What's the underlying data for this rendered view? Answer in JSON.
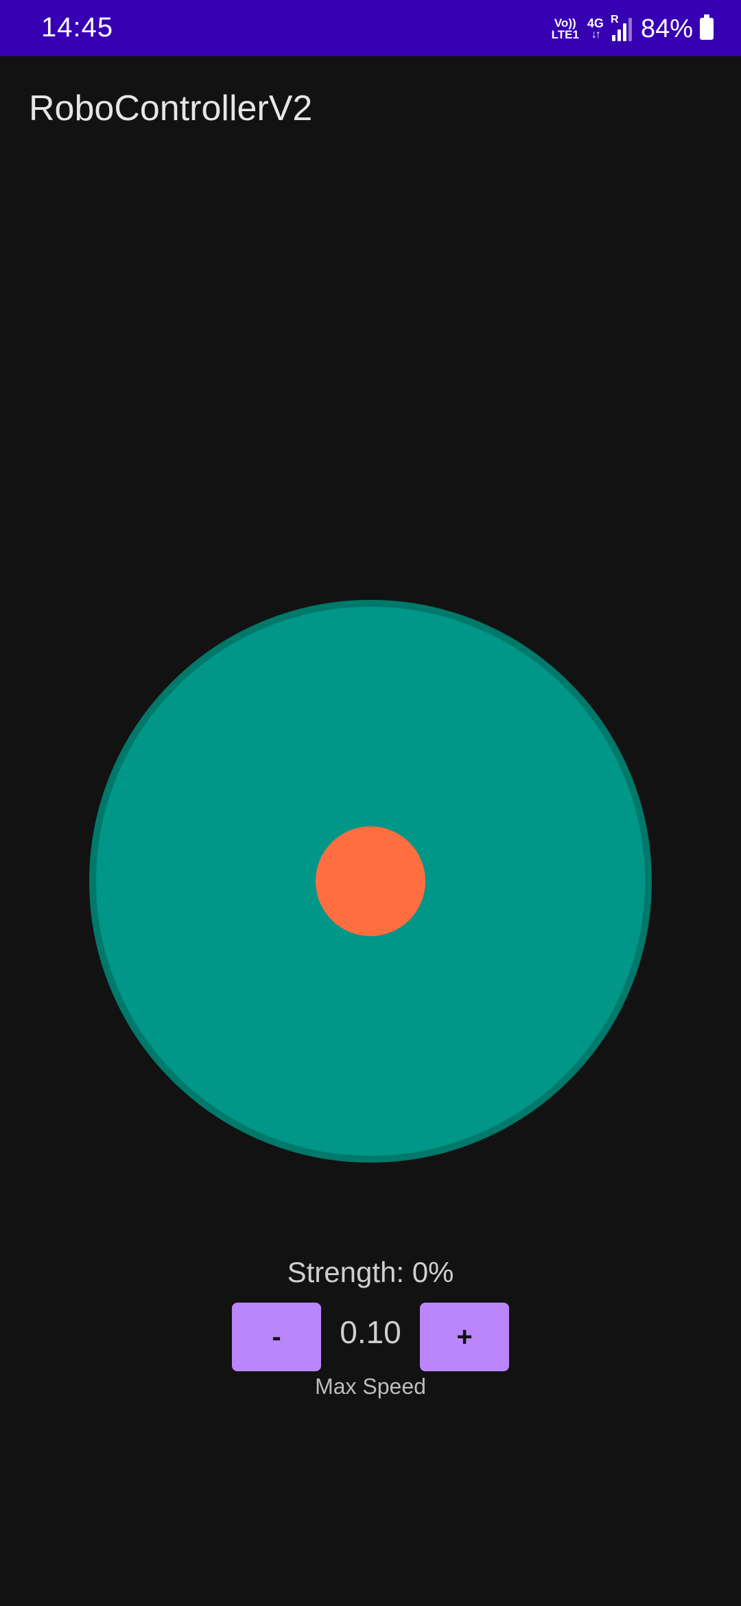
{
  "status_bar": {
    "time": "14:45",
    "volte_top": "Vo))",
    "volte_bottom": "LTE1",
    "network": "4G",
    "network_arrows": "↓↑",
    "roaming": "R",
    "battery_percent": "84%",
    "battery_level": 0.84,
    "background_color": "#3700b3"
  },
  "app": {
    "title": "RoboControllerV2"
  },
  "joystick": {
    "base_color": "#009688",
    "knob_color": "#ff6e40",
    "position": {
      "x": 0,
      "y": 0
    }
  },
  "controls": {
    "strength_text": "Strength: 0%",
    "strength_value": 0,
    "decrease_label": "-",
    "increase_label": "+",
    "max_speed_value": "0.10",
    "max_speed_label": "Max Speed",
    "button_color": "#bb86fc"
  }
}
